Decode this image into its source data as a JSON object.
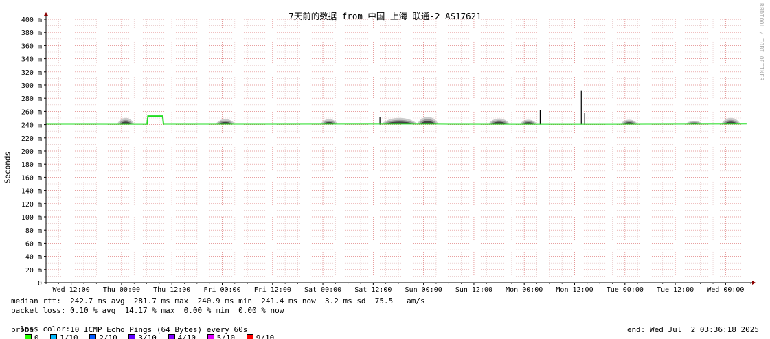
{
  "chart_data": {
    "type": "area",
    "title": "7天前的数据 from 中国 上海 联通-2 AS17621",
    "ylabel": "Seconds",
    "watermark": "RRDTOOL / TOBI OETIKER",
    "ylim": [
      0,
      400
    ],
    "y_ticks": [
      "400 m",
      "380 m",
      "360 m",
      "340 m",
      "320 m",
      "300 m",
      "280 m",
      "260 m",
      "240 m",
      "220 m",
      "200 m",
      "180 m",
      "160 m",
      "140 m",
      "120 m",
      "100 m",
      "80 m",
      "60 m",
      "40 m",
      "20 m",
      "0"
    ],
    "y_tick_values": [
      400,
      380,
      360,
      340,
      320,
      300,
      280,
      260,
      240,
      220,
      200,
      180,
      160,
      140,
      120,
      100,
      80,
      60,
      40,
      20,
      0
    ],
    "x_range_hours": [
      0,
      168
    ],
    "x_ticks": [
      {
        "label": "Wed 12:00",
        "hour": 6
      },
      {
        "label": "Thu 00:00",
        "hour": 18
      },
      {
        "label": "Thu 12:00",
        "hour": 30
      },
      {
        "label": "Fri 00:00",
        "hour": 42
      },
      {
        "label": "Fri 12:00",
        "hour": 54
      },
      {
        "label": "Sat 00:00",
        "hour": 66
      },
      {
        "label": "Sat 12:00",
        "hour": 78
      },
      {
        "label": "Sun 00:00",
        "hour": 90
      },
      {
        "label": "Sun 12:00",
        "hour": 102
      },
      {
        "label": "Mon 00:00",
        "hour": 114
      },
      {
        "label": "Mon 12:00",
        "hour": 126
      },
      {
        "label": "Tue 00:00",
        "hour": 138
      },
      {
        "label": "Tue 12:00",
        "hour": 150
      },
      {
        "label": "Wed 00:00",
        "hour": 162
      }
    ],
    "median_rtt_ms_series": [
      {
        "hour": 0,
        "value": 241.2
      },
      {
        "hour": 24,
        "value": 241.0
      },
      {
        "hour": 48,
        "value": 241.1
      },
      {
        "hour": 72,
        "value": 241.3
      },
      {
        "hour": 96,
        "value": 241.2
      },
      {
        "hour": 120,
        "value": 241.0
      },
      {
        "hour": 144,
        "value": 241.1
      },
      {
        "hour": 167,
        "value": 241.4
      }
    ],
    "plateau": {
      "start_hour": 24.3,
      "end_hour": 27.8,
      "value": 253
    },
    "spikes": [
      {
        "hour": 79.6,
        "value": 252
      },
      {
        "hour": 117.8,
        "value": 262
      },
      {
        "hour": 127.6,
        "value": 292
      },
      {
        "hour": 128.4,
        "value": 258
      }
    ],
    "jitter_bumps": [
      {
        "start_hour": 17,
        "end_hour": 21,
        "height": 10
      },
      {
        "start_hour": 40.5,
        "end_hour": 45,
        "height": 8
      },
      {
        "start_hour": 65.5,
        "end_hour": 69.5,
        "height": 8
      },
      {
        "start_hour": 80,
        "end_hour": 88.5,
        "height": 10
      },
      {
        "start_hour": 88.5,
        "end_hour": 93.5,
        "height": 12
      },
      {
        "start_hour": 105.5,
        "end_hour": 110.5,
        "height": 9
      },
      {
        "start_hour": 113,
        "end_hour": 117,
        "height": 7
      },
      {
        "start_hour": 137,
        "end_hour": 141,
        "height": 7
      },
      {
        "start_hour": 152.5,
        "end_hour": 156.5,
        "height": 5
      },
      {
        "start_hour": 161,
        "end_hour": 165.5,
        "height": 10
      }
    ],
    "colors": {
      "background": "#ffffff",
      "grid_minor": "#e0b8b8",
      "grid_major": "#e08080",
      "axis": "#000000",
      "arrow": "#8b0000",
      "median_line": "#22dd22",
      "jitter_dark": "#444444",
      "jitter_mid": "#9a9a9a",
      "jitter_light": "#cccccc"
    }
  },
  "stats": {
    "median_rtt": "median rtt:  242.7 ms avg  281.7 ms max  240.9 ms min  241.4 ms now  3.2 ms sd  75.5   am/s",
    "packet_loss": "packet loss: 0.10 % avg  14.17 % max  0.00 % min  0.00 % now",
    "loss_color_label": "loss color:",
    "loss_colors": [
      {
        "label": "0",
        "color": "#26ff00"
      },
      {
        "label": "1/10",
        "color": "#00b8ff"
      },
      {
        "label": "2/10",
        "color": "#0059ff"
      },
      {
        "label": "3/10",
        "color": "#5e00ff"
      },
      {
        "label": "4/10",
        "color": "#7e00ff"
      },
      {
        "label": "5/10",
        "color": "#dd00ff"
      },
      {
        "label": "9/10",
        "color": "#ff0000"
      }
    ],
    "probe": "probe:       10 ICMP Echo Pings (64 Bytes) every 60s",
    "end": "end: Wed Jul  2 03:36:18 2025"
  }
}
